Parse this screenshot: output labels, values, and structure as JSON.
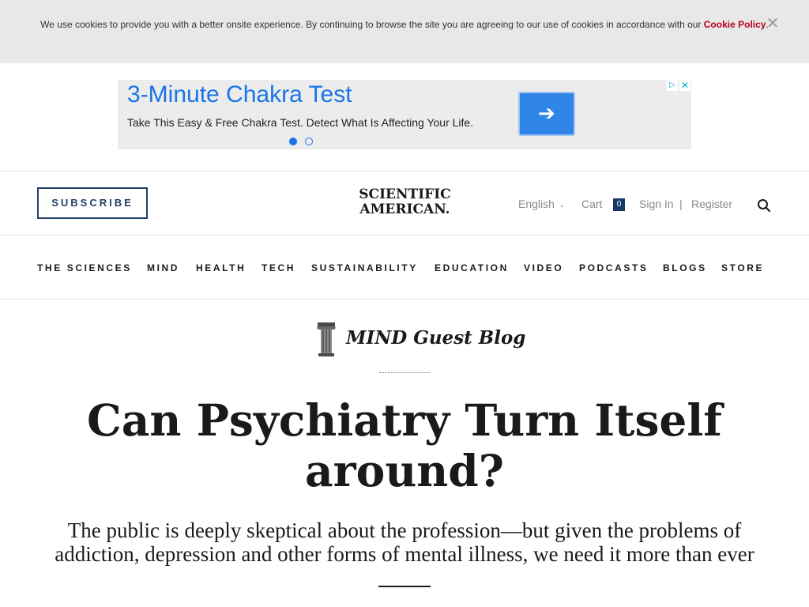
{
  "cookie_banner": {
    "text": "We use cookies to provide you with a better onsite experience. By continuing to browse the site you are agreeing to our use of cookies in accordance with our ",
    "link_label": "Cookie Policy",
    "text_end": ".",
    "close_icon": "close-icon",
    "close_glyph": "✕"
  },
  "ad": {
    "headline": "3-Minute Chakra Test",
    "body": "Take This Easy & Free Chakra Test. Detect What Is Affecting Your Life.",
    "cta_icon": "arrow-right-icon",
    "cta_glyph": "➔",
    "slide_count": 2,
    "active_slide": 1,
    "adchoices_icon": "adchoices-icon",
    "adchoices_glyph": "▷",
    "close_icon": "close-icon",
    "close_glyph": "✕",
    "colors": {
      "accent": "#1a73e8",
      "background": "#ececec"
    }
  },
  "header": {
    "subscribe_label": "SUBSCRIBE",
    "logo_line1": "SCIENTIFIC",
    "logo_line2": "AMERICAN.",
    "language": "English",
    "language_icon": "chevron-down-icon",
    "language_glyph": "⌄",
    "cart_label": "Cart",
    "cart_count": "0",
    "sign_in": "Sign In",
    "separator": "|",
    "register": "Register",
    "search_icon": "search-icon",
    "colors": {
      "brand_navy": "#1f3f66",
      "cart_badge": "#143a6a"
    }
  },
  "nav": {
    "items": [
      "THE SCIENCES",
      "MIND",
      "HEALTH",
      "TECH",
      "SUSTAINABILITY",
      "EDUCATION",
      "VIDEO",
      "PODCASTS",
      "BLOGS",
      "STORE"
    ]
  },
  "article": {
    "blog_icon": "column-icon",
    "blog_name": "MIND Guest Blog",
    "headline": "Can Psychiatry Turn Itself around?",
    "dek": "The public is deeply skeptical about the profession—but given the problems of addiction, depression and other forms of mental illness, we need it more than ever"
  }
}
